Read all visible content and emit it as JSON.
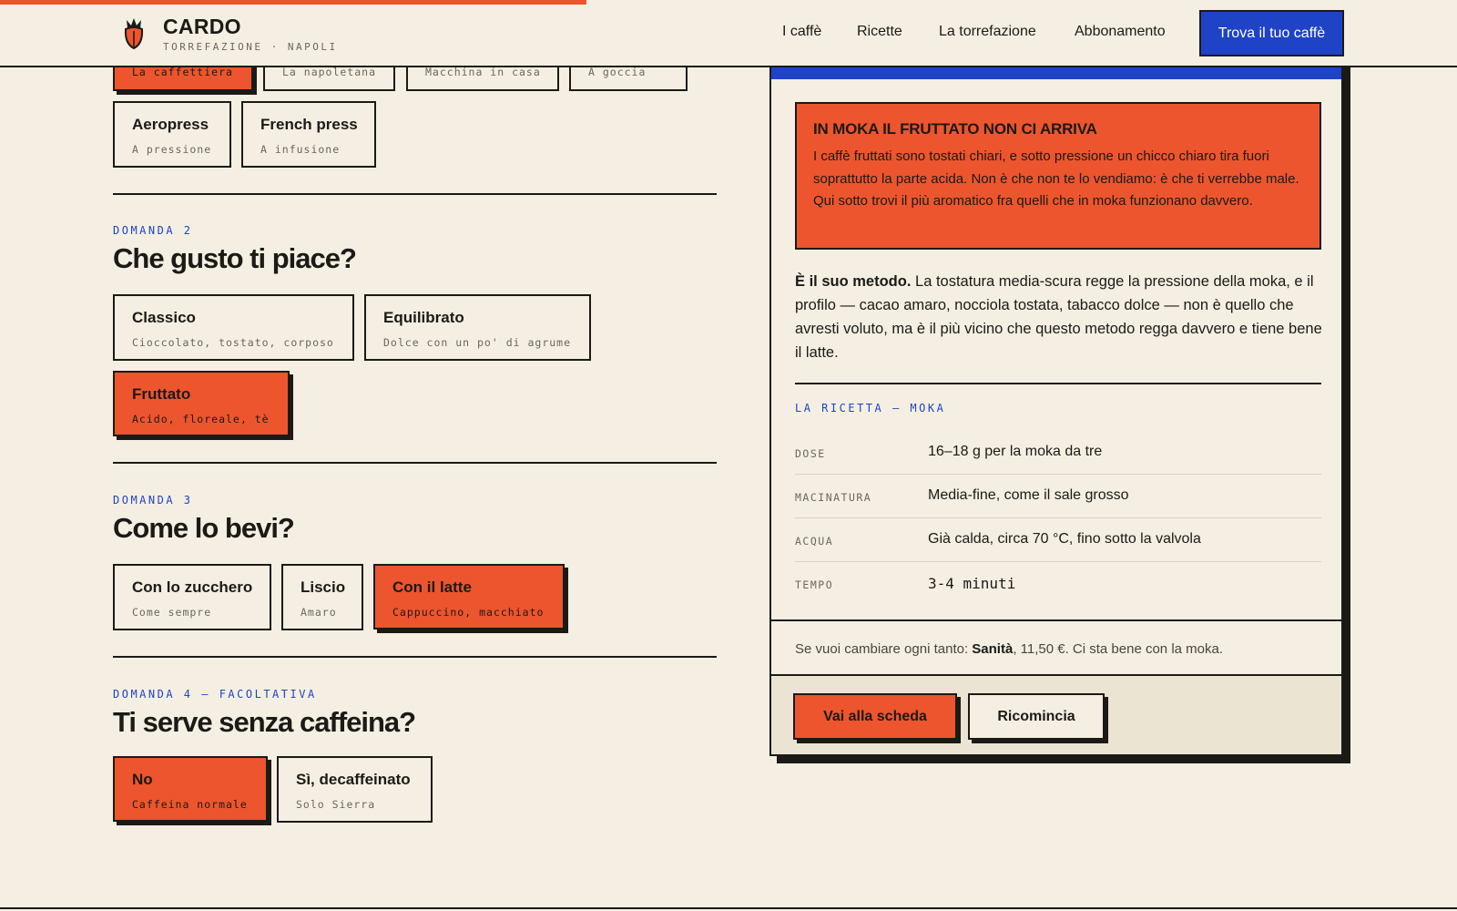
{
  "header": {
    "brand": "CARDO",
    "brand_sub": "TORREFAZIONE · NAPOLI",
    "nav": [
      "I caffè",
      "Ricette",
      "La torrefazione",
      "Abbonamento"
    ],
    "cta": "Trova il tuo caffè",
    "progress_fraction": 0.4,
    "colors": {
      "accent": "#ec552e",
      "blue": "#1f43c7",
      "ink": "#1c1a17",
      "paper": "#f4efe2"
    }
  },
  "q1": {
    "clipped_options": [
      "La caffettiera",
      "La napoletana",
      "Macchina in casa",
      "A goccia"
    ],
    "options": [
      {
        "title": "Aeropress",
        "sub": "A pressione"
      },
      {
        "title": "French press",
        "sub": "A infusione"
      }
    ]
  },
  "q2": {
    "label": "DOMANDA 2",
    "title": "Che gusto ti piace?",
    "options": [
      {
        "title": "Classico",
        "sub": "Cioccolato, tostato, corposo"
      },
      {
        "title": "Equilibrato",
        "sub": "Dolce con un po' di agrume"
      },
      {
        "title": "Fruttato",
        "sub": "Acido, floreale, tè",
        "selected": true
      }
    ]
  },
  "q3": {
    "label": "DOMANDA 3",
    "title": "Come lo bevi?",
    "options": [
      {
        "title": "Con lo zucchero",
        "sub": "Come sempre"
      },
      {
        "title": "Liscio",
        "sub": "Amaro"
      },
      {
        "title": "Con il latte",
        "sub": "Cappuccino, macchiato",
        "selected": true
      }
    ]
  },
  "q4": {
    "label": "DOMANDA 4 — FACOLTATIVA",
    "title": "Ti serve senza caffeina?",
    "options": [
      {
        "title": "No",
        "sub": "Caffeina normale",
        "selected": true
      },
      {
        "title": "Sì, decaffeinato",
        "sub": "Solo Sierra"
      }
    ]
  },
  "result": {
    "warning_title": "IN MOKA IL FRUTTATO NON CI ARRIVA",
    "warning_body": "I caffè fruttati sono tostati chiari, e sotto pressione un chicco chiaro tira fuori soprattutto la parte acida. Non è che non te lo vendiamo: è che ti verrebbe male. Qui sotto trovi il più aromatico fra quelli che in moka funzionano davvero.",
    "why_bold": "È il suo metodo.",
    "why_text": " La tostatura media-scura regge la pressione della moka, e il profilo — cacao amaro, nocciola tostata, tabacco dolce — non è quello che avresti voluto, ma è il più vicino che questo metodo regga davvero e tiene bene il latte.",
    "recipe_label": "LA RICETTA — MOKA",
    "recipe": [
      {
        "k": "DOSE",
        "v": "16–18 g per la moka da tre"
      },
      {
        "k": "MACINATURA",
        "v": "Media-fine, come il sale grosso"
      },
      {
        "k": "ACQUA",
        "v": "Già calda, circa 70 °C, fino sotto la valvola"
      },
      {
        "k": "TEMPO",
        "v": "3-4 minuti"
      }
    ],
    "alt_prefix": "Se vuoi cambiare ogni tanto: ",
    "alt_name": "Sanità",
    "alt_suffix": ", 11,50 €. Ci sta bene con la moka.",
    "btn_primary": "Vai alla scheda",
    "btn_secondary": "Ricomincia"
  }
}
